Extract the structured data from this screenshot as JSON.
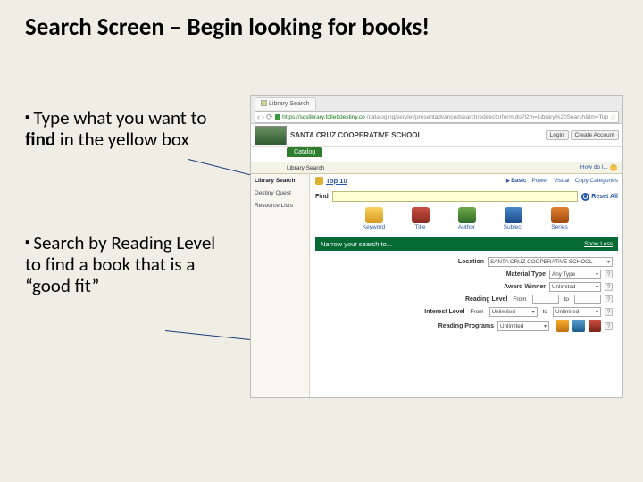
{
  "slide": {
    "title": "Search Screen – Begin looking for books!",
    "bullet1_pre": "Type what you want to ",
    "bullet1_bold": "find",
    "bullet1_post": " in the yellow box",
    "bullet2": "Search by Reading Level to find a book that is a “good fit”"
  },
  "browser": {
    "tab_label": "Library Search",
    "url_host": "https://scslibrary.follettdestiny.com",
    "url_path": "/cataloging/servlet/presentadvancedsearchredirectorform.do?l2m=Library%20Search&tm=TopLevel"
  },
  "header": {
    "school": "SANTA CRUZ COOPERATIVE SCHOOL",
    "login": "Login",
    "create_account": "Create Account",
    "catalog_tab": "Catalog",
    "library_search_tab": "Library Search",
    "how_do_i": "How do I..."
  },
  "sidebar": {
    "items": [
      "Library Search",
      "Destiny Quest",
      "Resource Lists"
    ]
  },
  "content": {
    "top10": "Top 10",
    "modes": {
      "basic": "Basic",
      "power": "Power",
      "visual": "Visual",
      "copy": "Copy Categories"
    },
    "find_label": "Find",
    "reset_all": "Reset All",
    "search_buttons": [
      "Keyword",
      "Title",
      "Author",
      "Subject",
      "Series"
    ],
    "narrow_title": "Narrow your search to...",
    "show_less": "Show Less",
    "form": {
      "location_label": "Location",
      "location_value": "SANTA CRUZ COOPERATIVE SCHOOL",
      "material_label": "Material Type",
      "material_value": "Any Type",
      "award_label": "Award Winner",
      "award_value": "Unlimited",
      "reading_label": "Reading Level",
      "reading_from": "From",
      "reading_to": "to",
      "interest_label": "Interest Level",
      "interest_from": "From",
      "interest_from_value": "Unlimited",
      "interest_to": "to",
      "interest_to_value": "Unlimited",
      "programs_label": "Reading Programs",
      "programs_value": "Unlimited"
    }
  }
}
